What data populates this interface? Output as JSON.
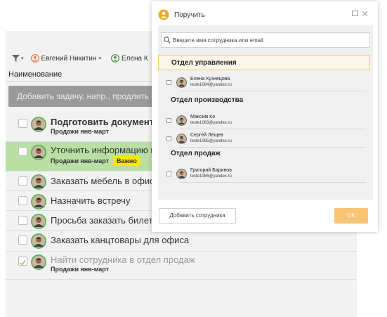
{
  "toolbar": {
    "users": [
      {
        "name": "Евгений Никитин",
        "caret": "▾"
      },
      {
        "name": "Елена К"
      }
    ]
  },
  "table": {
    "column_header": "Наименование",
    "add_task_placeholder": "Добавить задачу, напр., продлить аб"
  },
  "tasks": [
    {
      "title": "Подготовить документ",
      "project": "Продажи янв-март",
      "bold": true
    },
    {
      "title": "Уточнить информацию п",
      "project": "Продажи янв-март",
      "badge": "Важно",
      "highlighted": true
    },
    {
      "title": "Заказать мебель в офис"
    },
    {
      "title": "Назначить встречу"
    },
    {
      "title": "Просьба заказать билет"
    },
    {
      "title": "Заказать канцтовары для офиса"
    },
    {
      "title": "Найти сотрудника в отдел продаж",
      "project": "Продажи янв-март",
      "done": true
    }
  ],
  "modal": {
    "title": "Поручить",
    "search_placeholder": "Введите имя сотрудника или email",
    "departments": [
      {
        "name": "Отдел управления",
        "selected": true,
        "employees": [
          {
            "name": "Елена Кузнецова",
            "email": "teste1084@yandex.ru"
          }
        ]
      },
      {
        "name": "Отдел производства",
        "employees": [
          {
            "name": "Максим Ко",
            "email": "teste1083@yandex.ru"
          },
          {
            "name": "Сергей Лещев",
            "email": "teste1085@yandex.ru"
          }
        ]
      },
      {
        "name": "Отдел продаж",
        "employees": [
          {
            "name": "Григорий Баринов",
            "email": "teste1086@yandex.ru"
          }
        ]
      }
    ],
    "add_employee_label": "Добавить сотрудника",
    "ok_label": "OK"
  },
  "colors": {
    "accent": "#f5a623",
    "ok_button": "#f9c474",
    "highlight_row": "#b9dfa5",
    "badge": "#ffe600",
    "avatar_ring": "#4caf50"
  }
}
